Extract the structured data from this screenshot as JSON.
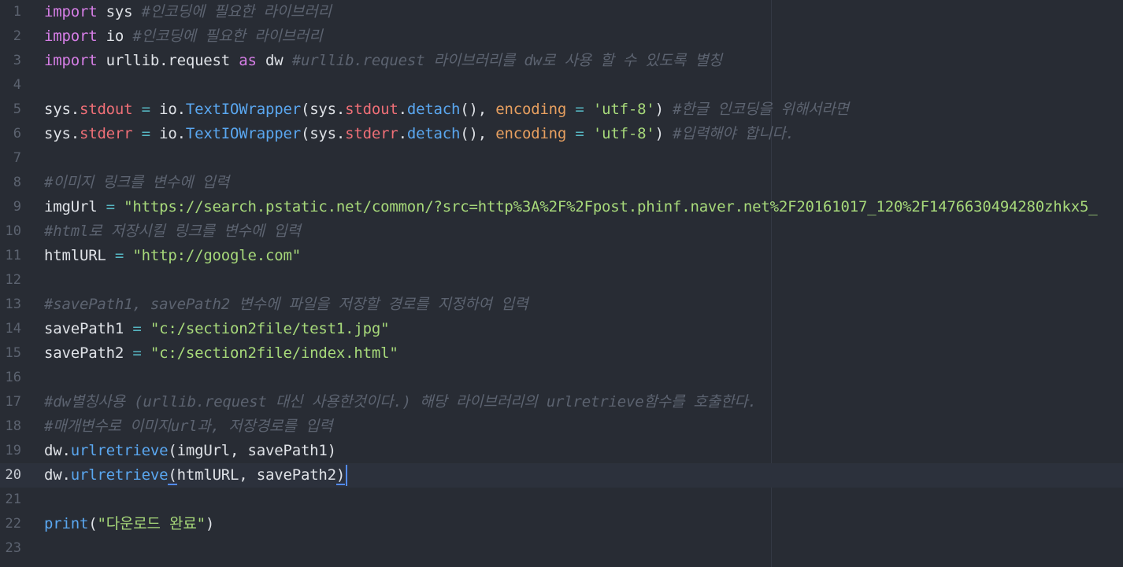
{
  "editor": {
    "language": "python",
    "cursor_line": 20,
    "colors": {
      "background": "#282c34",
      "keyword": "#d67ee6",
      "string": "#a7d97a",
      "comment": "#5c6370",
      "attribute": "#ef6f77",
      "function": "#5aa7f0",
      "parameter": "#e8a060",
      "operator": "#56b6c2",
      "caret": "#528bff"
    },
    "lines": [
      {
        "num": "1",
        "tokens": [
          {
            "t": "kw",
            "v": "import"
          },
          {
            "t": "plain",
            "v": " sys "
          },
          {
            "t": "cmt",
            "v": "#인코딩에 필요한 라이브러리"
          }
        ]
      },
      {
        "num": "2",
        "tokens": [
          {
            "t": "kw",
            "v": "import"
          },
          {
            "t": "plain",
            "v": " io "
          },
          {
            "t": "cmt",
            "v": "#인코딩에 필요한 라이브러리"
          }
        ]
      },
      {
        "num": "3",
        "tokens": [
          {
            "t": "kw",
            "v": "import"
          },
          {
            "t": "plain",
            "v": " urllib.request "
          },
          {
            "t": "kw",
            "v": "as"
          },
          {
            "t": "plain",
            "v": " dw "
          },
          {
            "t": "cmt",
            "v": "#urllib.request 라이브러리를 dw로 사용 할 수 있도록 별칭"
          }
        ]
      },
      {
        "num": "4",
        "tokens": []
      },
      {
        "num": "5",
        "tokens": [
          {
            "t": "plain",
            "v": "sys."
          },
          {
            "t": "attr",
            "v": "stdout"
          },
          {
            "t": "op",
            "v": " = "
          },
          {
            "t": "plain",
            "v": "io."
          },
          {
            "t": "fn",
            "v": "TextIOWrapper"
          },
          {
            "t": "plain",
            "v": "(sys."
          },
          {
            "t": "attr",
            "v": "stdout"
          },
          {
            "t": "plain",
            "v": "."
          },
          {
            "t": "fn",
            "v": "detach"
          },
          {
            "t": "plain",
            "v": "(), "
          },
          {
            "t": "param",
            "v": "encoding"
          },
          {
            "t": "op",
            "v": " = "
          },
          {
            "t": "str",
            "v": "'utf-8'"
          },
          {
            "t": "plain",
            "v": ") "
          },
          {
            "t": "cmt",
            "v": "#한글 인코딩을 위해서라면"
          }
        ]
      },
      {
        "num": "6",
        "tokens": [
          {
            "t": "plain",
            "v": "sys."
          },
          {
            "t": "attr",
            "v": "stderr"
          },
          {
            "t": "op",
            "v": " = "
          },
          {
            "t": "plain",
            "v": "io."
          },
          {
            "t": "fn",
            "v": "TextIOWrapper"
          },
          {
            "t": "plain",
            "v": "(sys."
          },
          {
            "t": "attr",
            "v": "stderr"
          },
          {
            "t": "plain",
            "v": "."
          },
          {
            "t": "fn",
            "v": "detach"
          },
          {
            "t": "plain",
            "v": "(), "
          },
          {
            "t": "param",
            "v": "encoding"
          },
          {
            "t": "op",
            "v": " = "
          },
          {
            "t": "str",
            "v": "'utf-8'"
          },
          {
            "t": "plain",
            "v": ") "
          },
          {
            "t": "cmt",
            "v": "#입력해야 합니다."
          }
        ]
      },
      {
        "num": "7",
        "tokens": []
      },
      {
        "num": "8",
        "tokens": [
          {
            "t": "cmt",
            "v": "#이미지 링크를 변수에 입력"
          }
        ]
      },
      {
        "num": "9",
        "tokens": [
          {
            "t": "plain",
            "v": "imgUrl"
          },
          {
            "t": "op",
            "v": " = "
          },
          {
            "t": "str",
            "v": "\"https://search.pstatic.net/common/?src=http%3A%2F%2Fpost.phinf.naver.net%2F20161017_120%2F1476630494280zhkx5_"
          }
        ]
      },
      {
        "num": "10",
        "tokens": [
          {
            "t": "cmt",
            "v": "#html로 저장시킬 링크를 변수에 입력"
          }
        ]
      },
      {
        "num": "11",
        "tokens": [
          {
            "t": "plain",
            "v": "htmlURL"
          },
          {
            "t": "op",
            "v": " = "
          },
          {
            "t": "str",
            "v": "\"http://google.com\""
          }
        ]
      },
      {
        "num": "12",
        "tokens": []
      },
      {
        "num": "13",
        "tokens": [
          {
            "t": "cmt",
            "v": "#savePath1, savePath2 변수에 파일을 저장할 경로를 지정하여 입력"
          }
        ]
      },
      {
        "num": "14",
        "tokens": [
          {
            "t": "plain",
            "v": "savePath1"
          },
          {
            "t": "op",
            "v": " = "
          },
          {
            "t": "str",
            "v": "\"c:/section2file/test1.jpg\""
          }
        ]
      },
      {
        "num": "15",
        "tokens": [
          {
            "t": "plain",
            "v": "savePath2"
          },
          {
            "t": "op",
            "v": " = "
          },
          {
            "t": "str",
            "v": "\"c:/section2file/index.html\""
          }
        ]
      },
      {
        "num": "16",
        "tokens": []
      },
      {
        "num": "17",
        "tokens": [
          {
            "t": "cmt",
            "v": "#dw별칭사용 (urllib.request 대신 사용한것이다.) 해당 라이브러리의 urlretrieve함수를 호출한다."
          }
        ]
      },
      {
        "num": "18",
        "tokens": [
          {
            "t": "cmt",
            "v": "#매개변수로 이미지url과, 저장경로를 입력"
          }
        ]
      },
      {
        "num": "19",
        "tokens": [
          {
            "t": "plain",
            "v": "dw."
          },
          {
            "t": "fn",
            "v": "urlretrieve"
          },
          {
            "t": "plain",
            "v": "(imgUrl, savePath1)"
          }
        ]
      },
      {
        "num": "20",
        "tokens": [
          {
            "t": "plain",
            "v": "dw."
          },
          {
            "t": "fn",
            "v": "urlretrieve"
          },
          {
            "t": "bm",
            "v": "("
          },
          {
            "t": "plain",
            "v": "htmlURL, savePath2"
          },
          {
            "t": "bm",
            "v": ")"
          },
          {
            "t": "caret",
            "v": ""
          }
        ]
      },
      {
        "num": "21",
        "tokens": []
      },
      {
        "num": "22",
        "tokens": [
          {
            "t": "fn",
            "v": "print"
          },
          {
            "t": "plain",
            "v": "("
          },
          {
            "t": "str",
            "v": "\"다운로드 완료\""
          },
          {
            "t": "plain",
            "v": ")"
          }
        ]
      },
      {
        "num": "23",
        "tokens": []
      }
    ]
  }
}
